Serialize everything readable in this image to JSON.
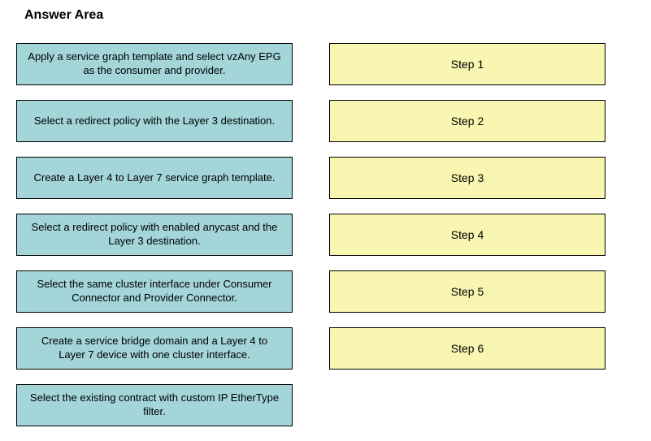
{
  "title": "Answer Area",
  "options": [
    "Apply a service graph template and select vzAny EPG as the consumer and provider.",
    "Select a redirect policy with the Layer 3 destination.",
    "Create a Layer 4 to Layer 7 service graph template.",
    "Select a redirect policy with enabled anycast and the Layer 3 destination.",
    "Select the same cluster interface under Consumer Connector and Provider Connector.",
    "Create a service bridge domain and a Layer 4 to Layer 7 device with one cluster interface.",
    "Select the existing contract with custom IP EtherType filter."
  ],
  "steps": [
    "Step 1",
    "Step 2",
    "Step 3",
    "Step 4",
    "Step 5",
    "Step 6"
  ]
}
